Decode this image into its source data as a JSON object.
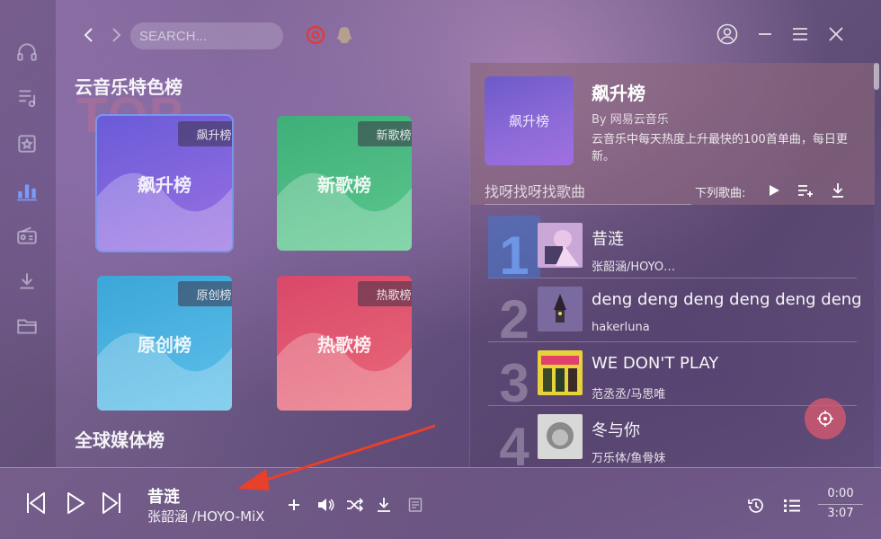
{
  "header": {
    "search_placeholder": "SEARCH...",
    "back_icon": "chevron-left-icon",
    "forward_icon": "chevron-right-icon"
  },
  "sections": {
    "featured_title": "云音乐特色榜",
    "global_title": "全球媒体榜",
    "bg_watermark": "TOP"
  },
  "cards": [
    {
      "title": "飙升榜",
      "tag": "飙升榜",
      "color_from": "#6a5bd8",
      "color_to": "#9b70e2"
    },
    {
      "title": "新歌榜",
      "tag": "新歌榜",
      "color_from": "#3fae78",
      "color_to": "#5cc88e"
    },
    {
      "title": "原创榜",
      "tag": "原创榜",
      "color_from": "#3ba6d8",
      "color_to": "#5fc0ea"
    },
    {
      "title": "热歌榜",
      "tag": "热歌榜",
      "color_from": "#d9486a",
      "color_to": "#ea6a78"
    }
  ],
  "panel": {
    "cover_label": "飙升榜",
    "title": "飙升榜",
    "by": "By 网易云音乐",
    "description": "云音乐中每天热度上升最快的100首单曲，每日更新。",
    "search_placeholder": "找呀找呀找歌曲",
    "next_label": "下列歌曲:"
  },
  "songs": [
    {
      "rank": "1",
      "name": "昔涟",
      "artist": "张韶涵/HOYO…"
    },
    {
      "rank": "2",
      "name": "deng deng deng deng deng deng",
      "artist": "hakerluna"
    },
    {
      "rank": "3",
      "name": "WE DON'T PLAY",
      "artist": "范丞丞/马思唯"
    },
    {
      "rank": "4",
      "name": "冬与你",
      "artist": "万乐体/鱼骨妹"
    }
  ],
  "player": {
    "title": "昔涟",
    "artist": "张韶涵 /HOYO-MiX",
    "elapsed": "0:00",
    "duration": "3:07"
  },
  "colors": {
    "accent": "#78a0ff",
    "fab": "#dc5a6e",
    "annotation_arrow": "#e8402a"
  }
}
